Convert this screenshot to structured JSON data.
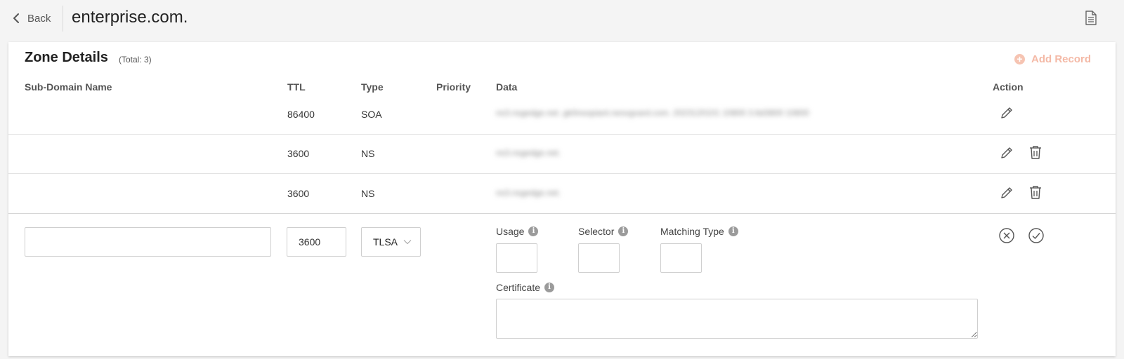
{
  "header": {
    "back_label": "Back",
    "zone_name": "enterprise.com."
  },
  "card": {
    "title": "Zone Details",
    "total": "(Total: 3)",
    "add_record_label": "Add Record"
  },
  "columns": {
    "subdomain": "Sub-Domain Name",
    "ttl": "TTL",
    "type": "Type",
    "priority": "Priority",
    "data": "Data",
    "action": "Action"
  },
  "records": [
    {
      "subdomain": "",
      "ttl": "86400",
      "type": "SOA",
      "priority": "",
      "data": "ns3.nsgedge.net. gk0noopiant.nesvgvard.com. 2023120101 10800 3.6d3800 10800"
    },
    {
      "subdomain": "",
      "ttl": "3600",
      "type": "NS",
      "priority": "",
      "data": "ns3.nsgedge.net."
    },
    {
      "subdomain": "",
      "ttl": "3600",
      "type": "NS",
      "priority": "",
      "data": "ns3.nsgedge.net."
    }
  ],
  "new_record": {
    "subdomain_value": "",
    "ttl_value": "3600",
    "type_value": "TLSA",
    "usage_label": "Usage",
    "selector_label": "Selector",
    "matching_type_label": "Matching Type",
    "certificate_label": "Certificate",
    "info_glyph": "i",
    "usage_value": "",
    "selector_value": "",
    "matching_type_value": "",
    "certificate_value": ""
  },
  "colors": {
    "accent_disabled": "#f4b9a6",
    "background": "#f4f4f4",
    "card": "#ffffff"
  }
}
